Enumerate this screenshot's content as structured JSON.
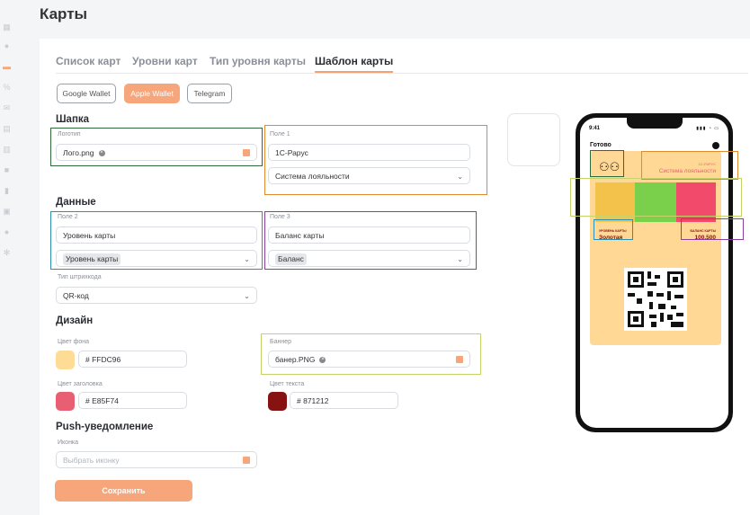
{
  "page": {
    "title": "Карты"
  },
  "tabs": [
    {
      "label": "Список карт"
    },
    {
      "label": "Уровни карт"
    },
    {
      "label": "Тип уровня карты"
    },
    {
      "label": "Шаблон карты"
    }
  ],
  "wallets": [
    {
      "label": "Google Wallet"
    },
    {
      "label": "Apple Wallet"
    },
    {
      "label": "Telegram"
    }
  ],
  "sections": {
    "header": "Шапка",
    "data": "Данные",
    "design": "Дизайн",
    "push": "Push-уведомление"
  },
  "header": {
    "logo_label": "Логотип",
    "logo_value": "Лого.png",
    "field1_label": "Поле 1",
    "field1_value": "1С-Рарус",
    "field1_select": "Система лояльности"
  },
  "data": {
    "field2_label": "Поле 2",
    "field2_value": "Уровень карты",
    "field2_select": "Уровень карты",
    "field3_label": "Поле 3",
    "field3_value": "Баланс карты",
    "field3_select": "Баланс",
    "barcode_label": "Тип штрихкода",
    "barcode_value": "QR-код"
  },
  "design": {
    "bg_label": "Цвет фона",
    "bg_value": "# FFDC96",
    "bg_color": "#ffdc96",
    "banner_label": "Баннер",
    "banner_value": "банер.PNG",
    "title_label": "Цвет заголовка",
    "title_value": "# E85F74",
    "title_color": "#e85f74",
    "text_label": "Цвет текста",
    "text_value": "# 871212",
    "text_color": "#871212"
  },
  "push": {
    "icon_label": "Иконка",
    "icon_placeholder": "Выбрать иконку"
  },
  "save_label": "Сохранить",
  "preview": {
    "time": "9:41",
    "done": "Готово",
    "field1_small": "1С-РАРУС",
    "field1_big": "Система лояльности",
    "field2_small": "УРОВЕНЬ КАРТЫ",
    "field2_value": "Золотая",
    "field3_small": "БАЛАНС КАРТЫ",
    "field3_value": "100.500"
  },
  "colors": {
    "accent": "#f7a57a"
  }
}
